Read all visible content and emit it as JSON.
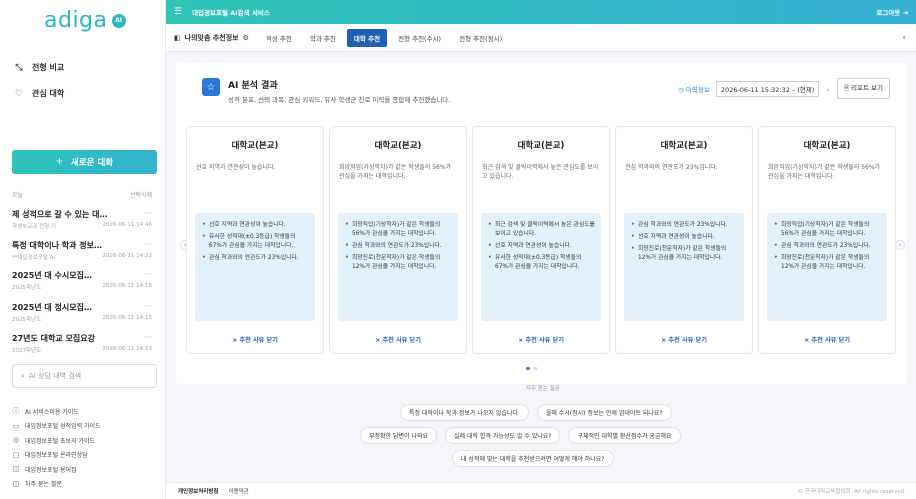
{
  "brand": {
    "logo_text": "adiga",
    "logo_badge": "AI"
  },
  "sidebar": {
    "menu": [
      {
        "label": "전형 비교",
        "icon": "compare-icon"
      },
      {
        "label": "관심 대학",
        "icon": "heart-icon"
      }
    ],
    "new_chat_label": "새로운 대화",
    "history_heading": "오늘",
    "history_edit": "선택삭제",
    "history": [
      {
        "title": "제 성적으로 갈 수 있는 대…",
        "sub": "학생부교과 전형 기",
        "time": "2026-06-11 14:46"
      },
      {
        "title": "특정 대학이나 학과 정보…",
        "sub": "**대입정보포털 AI",
        "time": "2026-06-11 14:22"
      },
      {
        "title": "2025년 대 수시모집…",
        "sub": "2025학년도",
        "time": "2026-06-11 14:16"
      },
      {
        "title": "2025년 대 정시모집…",
        "sub": "2025학년도",
        "time": "2026-06-11 14:15"
      },
      {
        "title": "27년도 대학교 모집요강",
        "sub": "2027학년도",
        "time": "2026-06-11 14:13"
      }
    ],
    "search_placeholder": "AI 상담 내역 검색",
    "footer_links": [
      {
        "label": "AI 서비스이용 가이드",
        "icon": "info-icon"
      },
      {
        "label": "대입정보포털 성적입력 가이드",
        "icon": "document-icon"
      },
      {
        "label": "대입정보포털 초보자 가이드",
        "icon": "guide-icon"
      },
      {
        "label": "대입정보포털 온라인상담",
        "icon": "chat-icon"
      },
      {
        "label": "대입정보포털 용어집",
        "icon": "book-icon"
      },
      {
        "label": "자주 묻는 질문",
        "icon": "faq-icon"
      }
    ]
  },
  "topbar": {
    "title": "대입정보포털 AI검색 서비스",
    "login": "로그아웃"
  },
  "tabs": {
    "lead_label": "나의맞춤 추천정보",
    "items": [
      {
        "label": "적성 추천",
        "active": false
      },
      {
        "label": "학과 추천",
        "active": false
      },
      {
        "label": "대학 추천",
        "active": true
      },
      {
        "label": "전형 추천(수시)",
        "active": false
      },
      {
        "label": "전형 추천(정시)",
        "active": false
      }
    ]
  },
  "result": {
    "title": "AI 분석 결과",
    "description": "성적 분포, 선택 과목, 관심 키워드, 유사 학생군 진로 이력을 종합해 추천했습니다.",
    "history_label": "이력정보",
    "history_value": "2026-06-11 15:32:32 – (현재)",
    "report_label": "리포트 보기"
  },
  "cards": [
    {
      "title": "대학교(본교)",
      "summary": "선호 지역과 연관성이 높습니다.",
      "reasons": [
        "선호 지역과 연관성이 높습니다.",
        "유사한 성적대(±0.3등급) 학생들의 67%가 관심을 가지는 대학입니다.",
        "관심 학과와의 연관도가 23%입니다."
      ],
      "close_label": "× 추천 사유 닫기"
    },
    {
      "title": "대학교(본교)",
      "summary": "희망직업(기상학자)가 같은 학생들의 56%가 관심을 가지는 대학입니다.",
      "reasons": [
        "희망직업(기상학자)가 같은 학생들의 56%가 관심을 가지는 대학입니다.",
        "관심 학과와의 연관도가 23%입니다.",
        "희망진로(천문학자)가 같은 학생들의 12%가 관심을 가지는 대학입니다."
      ],
      "close_label": "× 추천 사유 닫기"
    },
    {
      "title": "대학교(본교)",
      "summary": "최근 검색 및 클릭이력에서 높은 관심도를 보이고 있습니다.",
      "reasons": [
        "최근 검색 및 클릭이력에서 높은 관심도를 보이고 있습니다.",
        "선호 지역과 연관성이 높습니다.",
        "유사한 성적대(±0.3등급) 학생들의 67%가 관심을 가지는 대학입니다."
      ],
      "close_label": "× 추천 사유 닫기"
    },
    {
      "title": "대학교(본교)",
      "summary": "관심 학과와의 연관도가 23%입니다.",
      "reasons": [
        "관심 학과와의 연관도가 23%입니다.",
        "선호 지역과 연관성이 높습니다.",
        "희망진로(천문학자)가 같은 학생들의 12%가 관심을 가지는 대학입니다."
      ],
      "close_label": "× 추천 사유 닫기"
    },
    {
      "title": "대학교(본교)",
      "summary": "희망직업(기상학자)가 같은 학생들의 56%가 관심을 가지는 대학입니다.",
      "reasons": [
        "희망직업(기상학자)가 같은 학생들의 56%가 관심을 가지는 대학입니다.",
        "관심 학과와의 연관도가 23%입니다.",
        "희망진로(천문학자)가 같은 학생들의 12%가 관심을 가지는 대학입니다."
      ],
      "close_label": "× 추천 사유 닫기"
    }
  ],
  "faq": {
    "label": "자주 묻는 질문",
    "chips": [
      "특정 대학이나 학과 정보가 나오지 않습니다.",
      "올해 수시(정시) 정보는 언제 업데이트 되나요?",
      "부정확한 답변이 나와요",
      "실제 대학 합격 가능성도 알 수 있나요?",
      "구체적인 대학별 환산점수가 궁금해요",
      "내 성적에 맞는 대학을 추천받으려면 어떻게 해야 하나요?"
    ]
  },
  "footer": {
    "privacy": "개인정보처리방침",
    "terms": "이용약관",
    "copyright": "© 한국대학교육협의회. All rights reserved."
  },
  "colors": {
    "accent": "#2ec4b6",
    "primary": "#1f5fb5",
    "card_box": "#e4f1fa"
  }
}
